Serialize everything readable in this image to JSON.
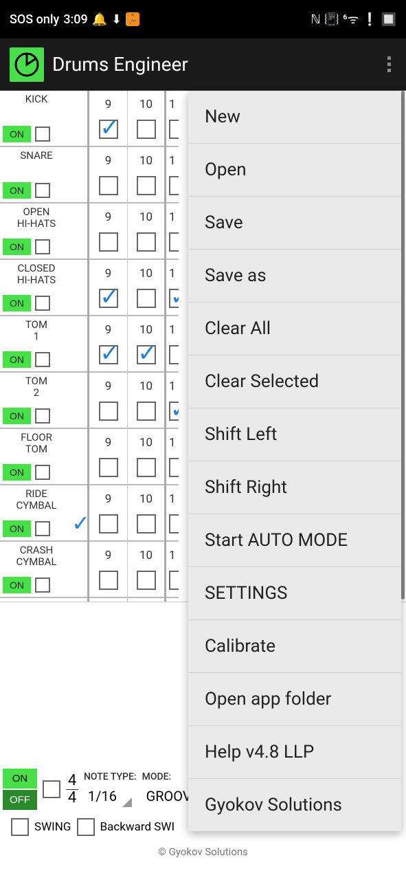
{
  "status_bar": {
    "sos": "SOS only",
    "time": "3:09",
    "icons": [
      "bell",
      "download",
      "running",
      "nfc",
      "vibrate",
      "wifi6",
      "alert",
      "battery"
    ]
  },
  "app": {
    "title": "Drums Engineer"
  },
  "tracks": [
    {
      "name": "KICK",
      "on_label": "ON",
      "cells": [
        {
          "n": "9",
          "c": true
        },
        {
          "n": "10",
          "c": false
        },
        {
          "n_partial": "1"
        }
      ]
    },
    {
      "name": "SNARE",
      "on_label": "ON",
      "cells": [
        {
          "n": "9",
          "c": false
        },
        {
          "n": "10",
          "c": false
        },
        {
          "n_partial": "1"
        }
      ]
    },
    {
      "name": "OPEN HI-HATS",
      "on_label": "ON",
      "cells": [
        {
          "n": "9",
          "c": false
        },
        {
          "n": "10",
          "c": false
        },
        {
          "n_partial": "1"
        }
      ]
    },
    {
      "name": "CLOSED HI-HATS",
      "on_label": "ON",
      "cells": [
        {
          "n": "9",
          "c": true
        },
        {
          "n": "10",
          "c": false
        },
        {
          "n_partial": "1",
          "partial_checked": true
        }
      ]
    },
    {
      "name": "TOM 1",
      "on_label": "ON",
      "cells": [
        {
          "n": "9",
          "c": true
        },
        {
          "n": "10",
          "c": true
        },
        {
          "n_partial": "1"
        }
      ]
    },
    {
      "name": "TOM 2",
      "on_label": "ON",
      "cells": [
        {
          "n": "9",
          "c": false
        },
        {
          "n": "10",
          "c": false
        },
        {
          "n_partial": "1",
          "partial_checked": true
        }
      ]
    },
    {
      "name": "FLOOR TOM",
      "on_label": "ON",
      "cells": [
        {
          "n": "9",
          "c": false
        },
        {
          "n": "10",
          "c": false
        },
        {
          "n_partial": "1"
        }
      ]
    },
    {
      "name": "RIDE CYMBAL",
      "on_label": "ON",
      "spacer_check": true,
      "cells": [
        {
          "n": "9",
          "c": false
        },
        {
          "n": "10",
          "c": false
        },
        {
          "n_partial": "1"
        }
      ]
    },
    {
      "name": "CRASH CYMBAL",
      "on_label": "ON",
      "cells": [
        {
          "n": "9",
          "c": false
        },
        {
          "n": "10",
          "c": false
        },
        {
          "n_partial": "1"
        }
      ]
    }
  ],
  "bottom": {
    "on": "ON",
    "off": "OFF",
    "ts_num": "4",
    "ts_den": "4",
    "note_type_label": "NOTE TYPE:",
    "note_type_value": "1/16",
    "mode_label": "MODE:",
    "mode_value": "GROOVE",
    "swing": "SWING",
    "backward": "Backward SWI"
  },
  "footer": "© Gyokov Solutions",
  "menu": {
    "items": [
      "New",
      "Open",
      "Save",
      "Save as",
      "Clear All",
      "Clear Selected",
      "Shift Left",
      "Shift Right",
      "Start AUTO MODE",
      "SETTINGS",
      "Calibrate",
      "Open app folder",
      "Help v4.8 LLP",
      "Gyokov Solutions"
    ]
  }
}
